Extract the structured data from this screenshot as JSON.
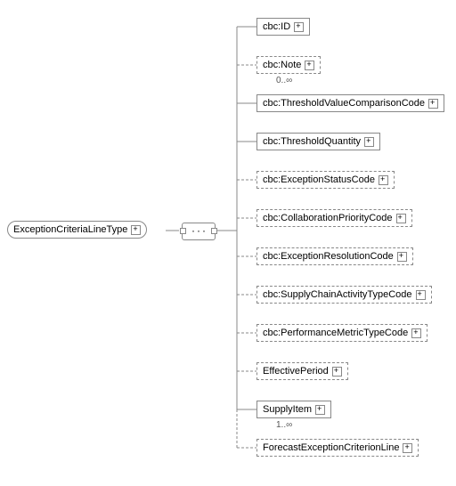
{
  "root": {
    "label": "ExceptionCriteriaLineType"
  },
  "children": [
    {
      "label": "cbc:ID",
      "optional": false,
      "card": null
    },
    {
      "label": "cbc:Note",
      "optional": true,
      "card": "0..∞"
    },
    {
      "label": "cbc:ThresholdValueComparisonCode",
      "optional": false,
      "card": null
    },
    {
      "label": "cbc:ThresholdQuantity",
      "optional": false,
      "card": null
    },
    {
      "label": "cbc:ExceptionStatusCode",
      "optional": true,
      "card": null
    },
    {
      "label": "cbc:CollaborationPriorityCode",
      "optional": true,
      "card": null
    },
    {
      "label": "cbc:ExceptionResolutionCode",
      "optional": true,
      "card": null
    },
    {
      "label": "cbc:SupplyChainActivityTypeCode",
      "optional": true,
      "card": null
    },
    {
      "label": "cbc:PerformanceMetricTypeCode",
      "optional": true,
      "card": null
    },
    {
      "label": "EffectivePeriod",
      "optional": true,
      "card": null
    },
    {
      "label": "SupplyItem",
      "optional": false,
      "card": "1..∞"
    },
    {
      "label": "ForecastExceptionCriterionLine",
      "optional": true,
      "card": null
    }
  ]
}
